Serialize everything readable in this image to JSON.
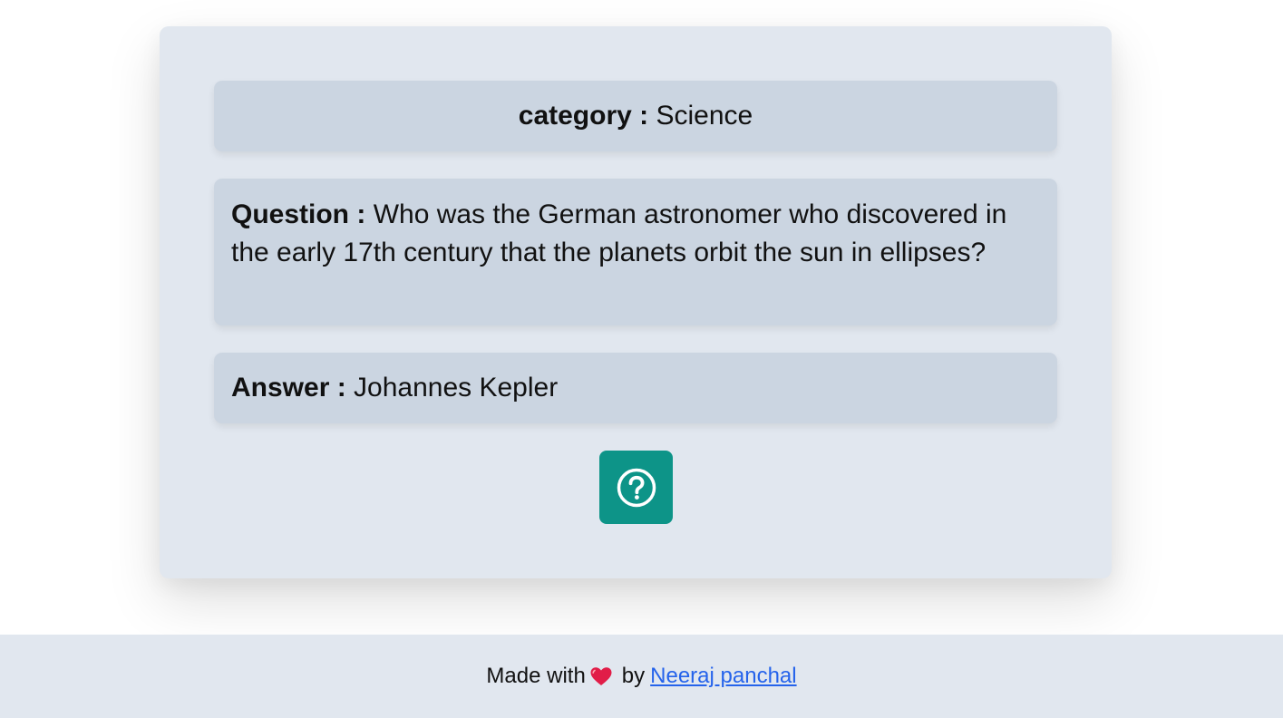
{
  "quiz": {
    "category_label": "category :",
    "category_value": "Science",
    "question_label": "Question :",
    "question_text": "Who was the German astronomer who discovered in the early 17th century that the planets orbit the sun in ellipses?",
    "answer_label": "Answer :",
    "answer_text": "Johannes Kepler",
    "help_icon": "question-circle-icon"
  },
  "footer": {
    "made_with": "Made with",
    "heart_icon": "heart-icon",
    "by": "by",
    "author_link": "Neeraj panchal"
  },
  "colors": {
    "card_bg": "#e1e7ef",
    "panel_bg": "#cbd5e1",
    "button_bg": "#0d9488",
    "link": "#2563eb",
    "heart": "#e11d48"
  }
}
